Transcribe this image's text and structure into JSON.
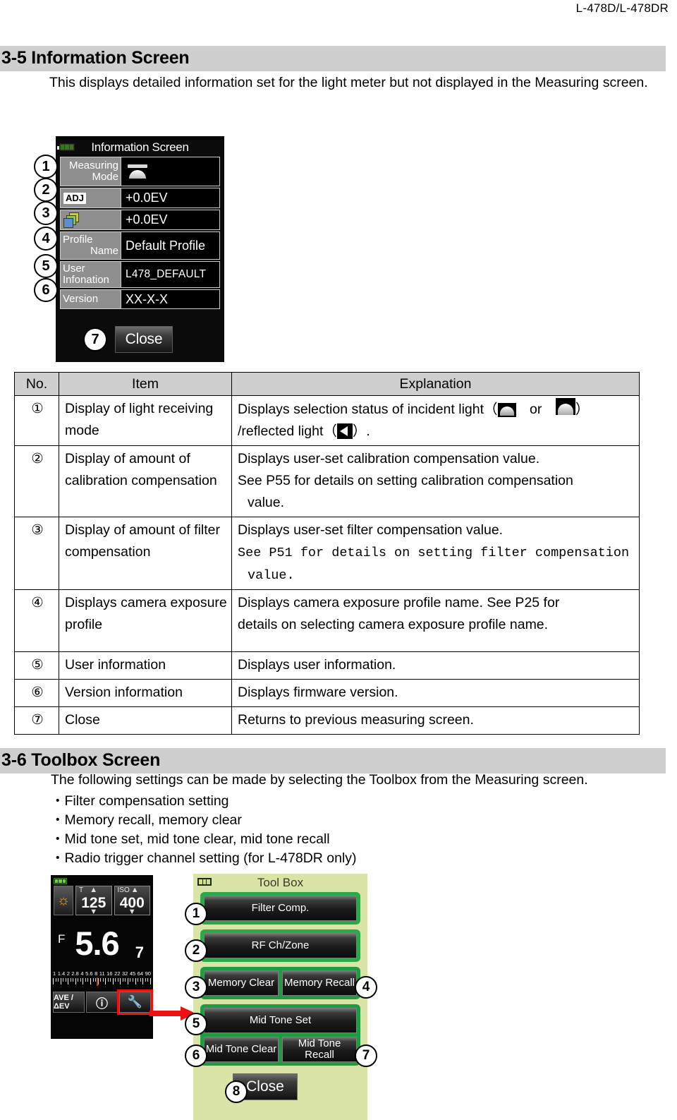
{
  "page": {
    "header_right": "L-478D/L-478DR"
  },
  "section_info": {
    "heading": "3-5 Information Screen",
    "intro": "This displays detailed information set for the light meter but not displayed in the Measuring screen."
  },
  "info_screen": {
    "title": "Information Screen",
    "battery_icon": "battery-icon",
    "rows": [
      {
        "label_line1": "Measuring",
        "label_line2": "Mode",
        "value": "",
        "value_icon": "incident-dome-icon",
        "callout": "1"
      },
      {
        "label_line1": "ADJ",
        "label_line2": "",
        "value": "+0.0EV",
        "value_icon": "",
        "callout": "2"
      },
      {
        "label_line1": "",
        "label_line2": "",
        "value": "+0.0EV",
        "value_icon": "filter-stack-icon",
        "callout": "3"
      },
      {
        "label_line1": "Profile",
        "label_line2": "Name",
        "value": "Default Profile",
        "value_icon": "",
        "callout": "4"
      },
      {
        "label_line1": "User",
        "label_line2": "Infonation",
        "value": "L478_DEFAULT",
        "value_icon": "",
        "callout": "5"
      },
      {
        "label_line1": "Version",
        "label_line2": "",
        "value": "XX-X-X",
        "value_icon": "",
        "callout": "6"
      }
    ],
    "close_label": "Close",
    "close_callout": "7"
  },
  "spec_table": {
    "headers": [
      "No.",
      "Item",
      "Explanation"
    ],
    "rows": [
      {
        "no": "①",
        "item": "Display of light receiving mode",
        "exp_pre": "Displays selection status of incident light（",
        "exp_mid": "　or　",
        "exp_post": "）",
        "exp_line2_pre": "/reflected light（",
        "exp_line2_post": "）."
      },
      {
        "no": "②",
        "item": "Display of amount of calibration compensation",
        "exp_l1": "Displays user-set calibration compensation value.",
        "exp_l2": "See P55 for details on setting calibration compensation",
        "exp_l3": "value."
      },
      {
        "no": "③",
        "item": "Display of amount of filter compensation",
        "exp_l1": "Displays user-set filter compensation value.",
        "exp_l2": "See P51 for details on setting filter compensation",
        "exp_l3": "value."
      },
      {
        "no": "④",
        "item": "Displays camera exposure profile",
        "exp_l1": "Displays camera exposure profile name. See P25 for",
        "exp_l2": "details on selecting camera exposure profile name."
      },
      {
        "no": "⑤",
        "item": "User information",
        "exp_l1": "Displays user information."
      },
      {
        "no": "⑥",
        "item": "Version information",
        "exp_l1": "Displays firmware version."
      },
      {
        "no": "⑦",
        "item": "Close",
        "exp_l1": "Returns to previous measuring screen."
      }
    ]
  },
  "section_toolbox": {
    "heading": "3-6 Toolbox Screen",
    "intro": "The following settings can be made by selecting the Toolbox from the Measuring screen.",
    "bullets": [
      "・Filter compensation setting",
      "・Memory recall, memory clear",
      "・Mid tone set, mid tone clear, mid tone recall",
      "・Radio trigger channel setting (for L-478DR only)"
    ]
  },
  "meter_screen": {
    "sun_icon": "sun-icon",
    "shutter": {
      "tag": "T",
      "value": "125"
    },
    "iso": {
      "tag": "ISO",
      "value": "400"
    },
    "aperture": {
      "label": "F",
      "value": "5.6",
      "fraction": "7"
    },
    "scale_labels": [
      "1",
      "1.4",
      "2",
      "2.8",
      "4",
      "5.6",
      "8",
      "11",
      "16",
      "22",
      "32",
      "45",
      "64",
      "90"
    ],
    "bottom_buttons": [
      "AVE /ΔEV",
      "info-icon",
      "wrench-icon"
    ],
    "highlighted_button": "wrench-icon"
  },
  "toolbox_screen": {
    "title": "Tool Box",
    "buttons": [
      {
        "label": "Filter Comp.",
        "callout": "1"
      },
      {
        "label": "RF Ch/Zone",
        "callout": "2"
      },
      {
        "label": "Memory Clear",
        "callout": "3"
      },
      {
        "label": "Memory Recall",
        "callout": "4"
      },
      {
        "label": "Mid Tone Set",
        "callout": "5"
      },
      {
        "label": "Mid Tone Clear",
        "callout": "6"
      },
      {
        "label": "Mid Tone Recall",
        "callout": "7"
      }
    ],
    "close_label": "Close",
    "close_callout": "8"
  },
  "colors": {
    "heading_bar": "#cfcfcf",
    "toolbox_bg": "#d9e4a6",
    "toolbox_group": "#2aa84a",
    "highlight": "#ef1010",
    "battery_green": "#6fd13c"
  }
}
